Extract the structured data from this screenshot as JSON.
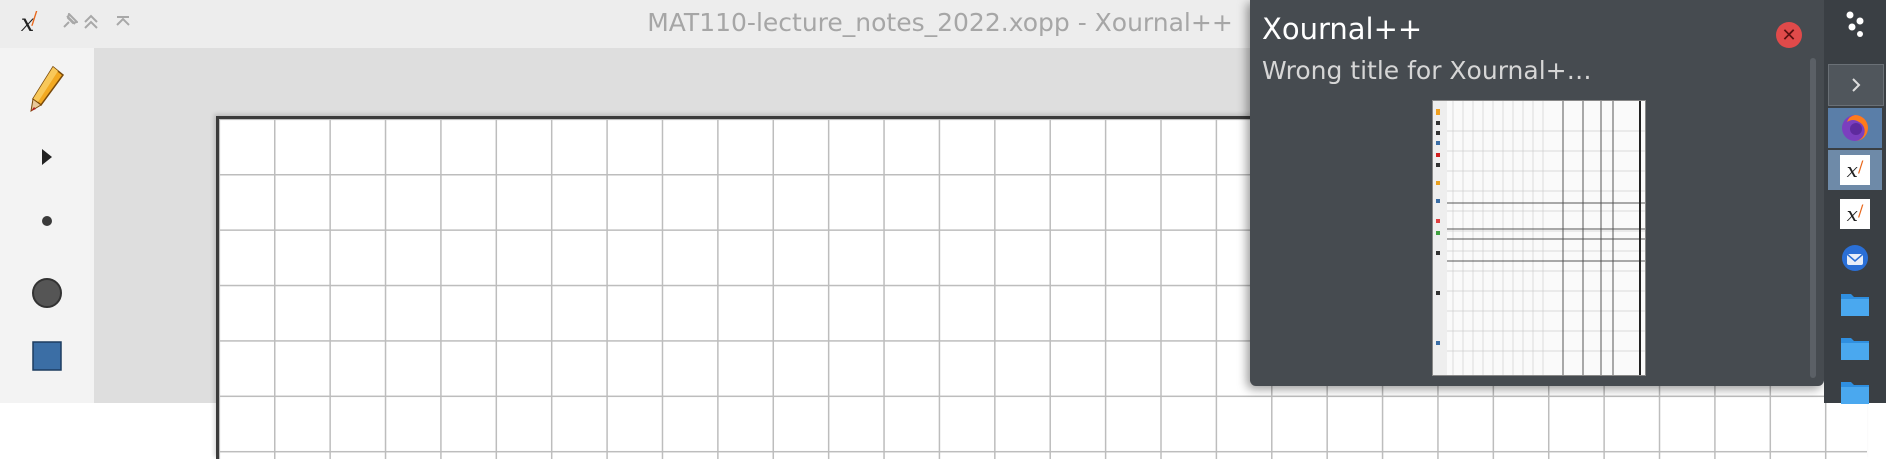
{
  "window": {
    "title": "MAT110-lecture_notes_2022.xopp - Xournal++",
    "app_logo": "x"
  },
  "titlebar_buttons": [
    {
      "name": "pin-icon",
      "glyph": "✦"
    },
    {
      "name": "keep-above-icon",
      "glyph": "︽"
    },
    {
      "name": "keep-below-icon",
      "glyph": "⌃"
    }
  ],
  "tools": [
    {
      "name": "pen-tool-icon"
    },
    {
      "name": "select-arrow-icon"
    },
    {
      "name": "pen-size-small-icon"
    },
    {
      "name": "pen-size-large-icon"
    },
    {
      "name": "fill-color-icon",
      "color": "#3b6ea5"
    }
  ],
  "notification": {
    "title": "Xournal++",
    "body": "Wrong title for Xournal+…"
  },
  "dock": {
    "items": [
      {
        "name": "dock-menu-icon"
      },
      {
        "name": "dock-expand-icon"
      },
      {
        "name": "firefox-icon"
      },
      {
        "name": "xournal-icon-active"
      },
      {
        "name": "xournal-icon"
      },
      {
        "name": "thunderbird-icon"
      },
      {
        "name": "folder-icon-1"
      },
      {
        "name": "folder-icon-2"
      },
      {
        "name": "folder-icon-3"
      }
    ]
  },
  "colors": {
    "titlebar": "#ededed",
    "canvas_bg": "#dedede",
    "grid_line": "#bdbdbd",
    "notification_bg": "#464b50",
    "dock_bg": "#3a3f44",
    "dock_active": "#5a7ea8",
    "close_button": "#e04a4a",
    "pen_orange": "#f0a020"
  }
}
